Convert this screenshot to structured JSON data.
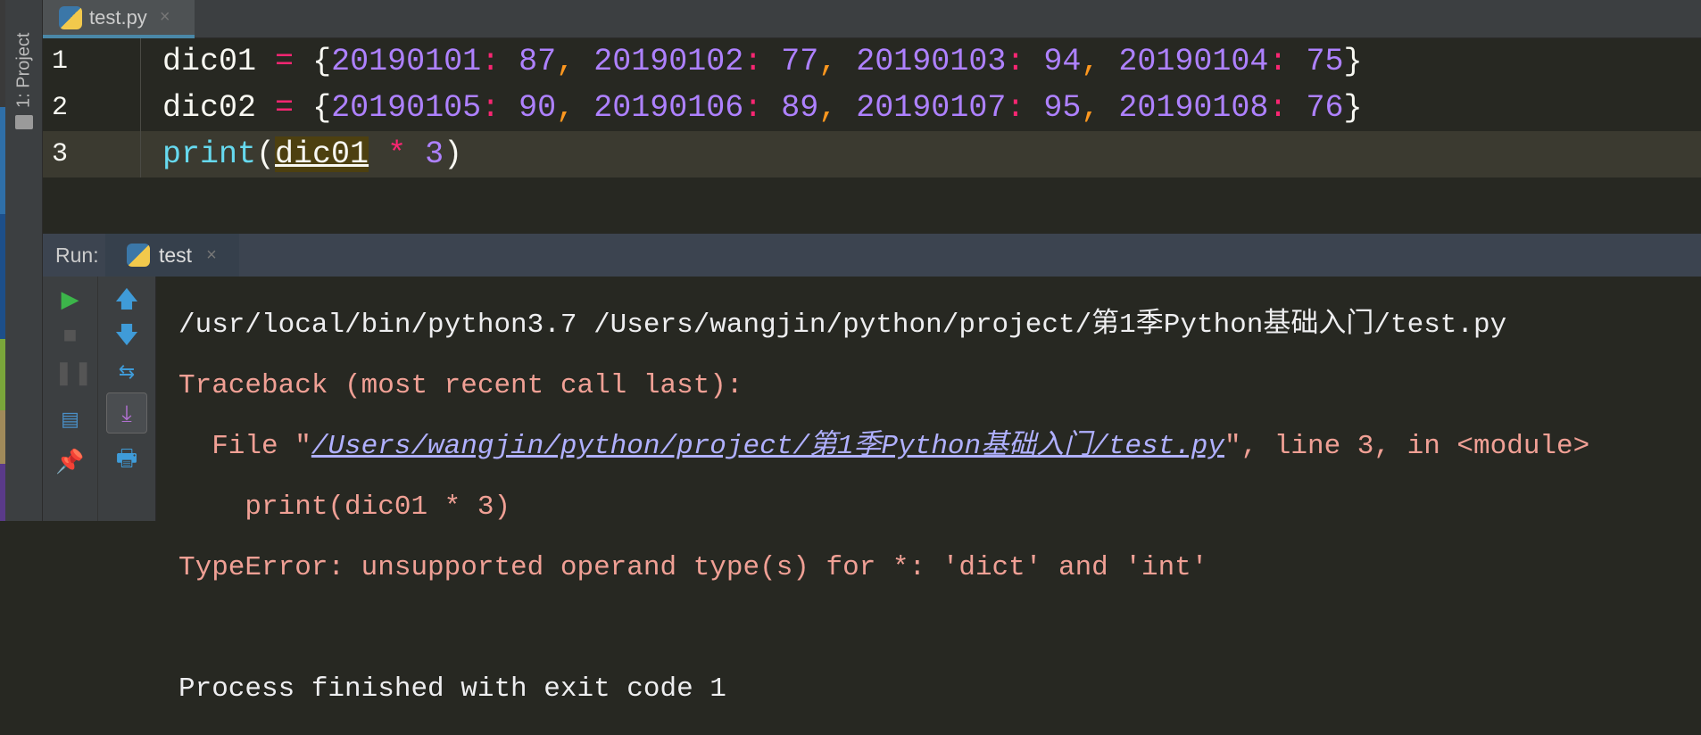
{
  "sidebar": {
    "project_label": "1: Project"
  },
  "file_tab": {
    "label": "test.py",
    "close": "×"
  },
  "editor": {
    "lines": [
      {
        "num": "1",
        "name": "dic01",
        "pairs": [
          [
            "20190101",
            "87"
          ],
          [
            "20190102",
            "77"
          ],
          [
            "20190103",
            "94"
          ],
          [
            "20190104",
            "75"
          ]
        ]
      },
      {
        "num": "2",
        "name": "dic02",
        "pairs": [
          [
            "20190105",
            "90"
          ],
          [
            "20190106",
            "89"
          ],
          [
            "20190107",
            "95"
          ],
          [
            "20190108",
            "76"
          ]
        ]
      },
      {
        "num": "3",
        "fn": "print",
        "arg": "dic01",
        "op": "*",
        "n": "3"
      }
    ]
  },
  "run": {
    "label": "Run:",
    "tab": "test",
    "close": "×"
  },
  "console": {
    "cmd": "/usr/local/bin/python3.7 /Users/wangjin/python/project/第1季Python基础入门/test.py",
    "tb_header": "Traceback (most recent call last):",
    "file_prefix": "  File \"",
    "file_link": "/Users/wangjin/python/project/第1季Python基础入门/test.py",
    "file_suffix": "\", line 3, in <module>",
    "src_line": "    print(dic01 * 3)",
    "error": "TypeError: unsupported operand type(s) for *: 'dict' and 'int'",
    "exit": "Process finished with exit code 1"
  }
}
